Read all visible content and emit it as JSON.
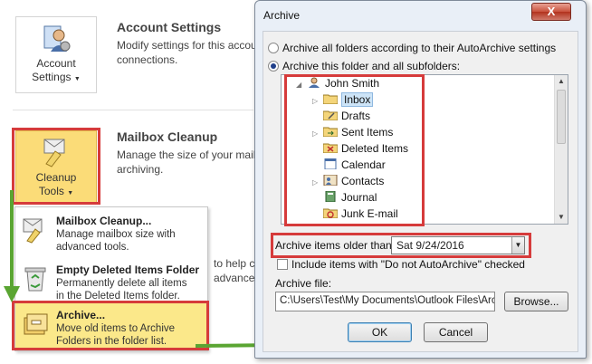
{
  "backstage": {
    "account": {
      "button_label_1": "Account",
      "button_label_2": "Settings",
      "title": "Account Settings",
      "desc_1": "Modify settings for this accou",
      "desc_2": "connections."
    },
    "cleanup": {
      "button_label_1": "Cleanup",
      "button_label_2": "Tools",
      "title": "Mailbox Cleanup",
      "desc_1": "Manage the size of your mail",
      "desc_2": "archiving."
    },
    "partial_1": "to help c",
    "partial_2": "advance update"
  },
  "menu": {
    "items": [
      {
        "title": "Mailbox Cleanup...",
        "desc_1": "Manage mailbox size with",
        "desc_2": "advanced tools."
      },
      {
        "title": "Empty Deleted Items Folder",
        "desc_1": "Permanently delete all items",
        "desc_2": "in the Deleted Items folder."
      },
      {
        "title": "Archive...",
        "desc_1": "Move old items to Archive",
        "desc_2": "Folders in the folder list."
      }
    ]
  },
  "dialog": {
    "title": "Archive",
    "close": "X",
    "radio_all": "Archive all folders according to their AutoArchive settings",
    "radio_this": "Archive this folder and all subfolders:",
    "tree": [
      {
        "label": "John Smith",
        "icon": "account-icon"
      },
      {
        "label": "Inbox",
        "icon": "inbox-folder-icon"
      },
      {
        "label": "Drafts",
        "icon": "drafts-icon"
      },
      {
        "label": "Sent Items",
        "icon": "sent-folder-icon"
      },
      {
        "label": "Deleted Items",
        "icon": "deleted-items-icon"
      },
      {
        "label": "Calendar",
        "icon": "calendar-icon"
      },
      {
        "label": "Contacts",
        "icon": "contacts-icon"
      },
      {
        "label": "Journal",
        "icon": "journal-icon"
      },
      {
        "label": "Junk E-mail",
        "icon": "junk-folder-icon"
      }
    ],
    "older_label": "Archive items older than:",
    "older_value": "Sat 9/24/2016",
    "include_label": "Include items with \"Do not AutoArchive\" checked",
    "file_label": "Archive file:",
    "file_value": "C:\\Users\\Test\\My Documents\\Outlook Files\\Archive.pst",
    "browse": "Browse...",
    "ok": "OK",
    "cancel": "Cancel"
  },
  "colors": {
    "highlight": "#d63b3b",
    "arrow": "#5aa532",
    "selected": "#fbe88a"
  }
}
